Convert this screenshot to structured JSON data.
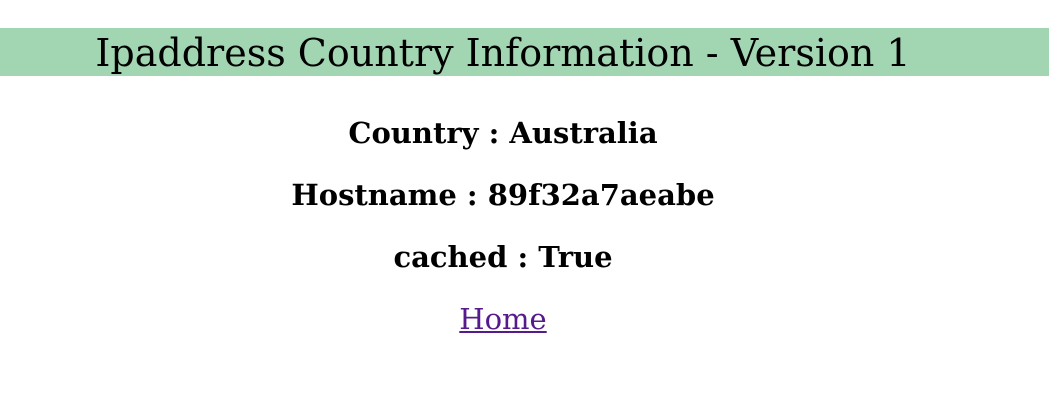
{
  "header": {
    "title": "Ipaddress Country Information - Version 1",
    "background_color": "#a2d6b2"
  },
  "info": {
    "country_label": "Country",
    "country_value": "Australia",
    "hostname_label": "Hostname",
    "hostname_value": "89f32a7aeabe",
    "cached_label": "cached",
    "cached_value": "True",
    "separator": " : "
  },
  "nav": {
    "home_label": "Home",
    "link_color": "#551a8b"
  }
}
